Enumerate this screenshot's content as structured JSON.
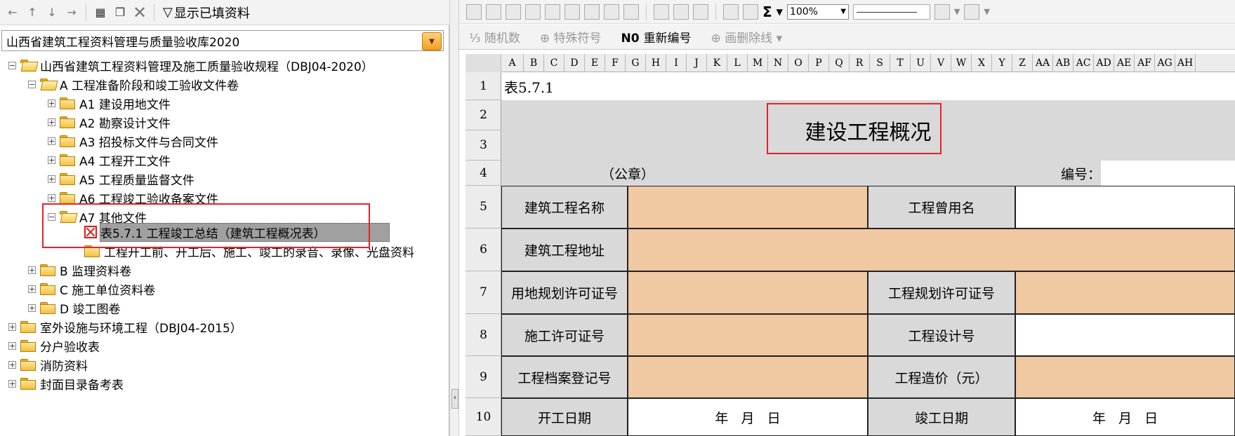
{
  "left_toolbar": {
    "show_filled_label": "显示已填资料"
  },
  "library_combo": {
    "value": "山西省建筑工程资料管理与质量验收库2020"
  },
  "tree": [
    {
      "label": "山西省建筑工程资料管理及施工质量验收规程（DBJ04-2020）"
    },
    {
      "label": "A 工程准备阶段和竣工验收文件卷"
    },
    {
      "label": "A1 建设用地文件"
    },
    {
      "label": "A2 勘察设计文件"
    },
    {
      "label": "A3 招投标文件与合同文件"
    },
    {
      "label": "A4 工程开工文件"
    },
    {
      "label": "A5 工程质量监督文件"
    },
    {
      "label": "A6 工程竣工验收备案文件"
    },
    {
      "label": "A7 其他文件"
    },
    {
      "label": "表5.7.1 工程竣工总结（建筑工程概况表）"
    },
    {
      "label": "工程开工前、开工后、施工、竣工的录音、录像、光盘资料"
    },
    {
      "label": "B 监理资料卷"
    },
    {
      "label": "C 施工单位资料卷"
    },
    {
      "label": "D 竣工图卷"
    },
    {
      "label": "室外设施与环境工程（DBJ04-2015）"
    },
    {
      "label": "分户验收表"
    },
    {
      "label": "消防资料"
    },
    {
      "label": "封面目录备考表"
    }
  ],
  "right_toolbar": {
    "zoom": "100%",
    "random_number": "随机数",
    "special_symbol": "特殊符号",
    "renumber": "重新编号",
    "strikethrough": "画删除线",
    "sum_symbol": "Σ"
  },
  "columns": [
    "A",
    "B",
    "C",
    "D",
    "E",
    "F",
    "G",
    "H",
    "I",
    "J",
    "K",
    "L",
    "M",
    "N",
    "O",
    "P",
    "Q",
    "R",
    "S",
    "T",
    "U",
    "V",
    "W",
    "X",
    "Y",
    "Z",
    "AA",
    "AB",
    "AC",
    "AD",
    "AE",
    "AF",
    "AG",
    "AH"
  ],
  "rows": [
    "1",
    "2",
    "3",
    "4",
    "5",
    "6",
    "7",
    "8",
    "9",
    "10"
  ],
  "sheet": {
    "table_no": "表5.7.1",
    "title": "建设工程概况",
    "seal": "（公章）",
    "number_label": "编号：",
    "name_label": "建筑工程名称",
    "used_name_label": "工程曾用名",
    "address_label": "建筑工程地址",
    "land_permit_label": "用地规划许可证号",
    "planning_permit_label": "工程规划许可证号",
    "construction_permit_label": "施工许可证号",
    "design_no_label": "工程设计号",
    "archive_no_label": "工程档案登记号",
    "cost_label": "工程造价（元）",
    "start_date_label": "开工日期",
    "date_placeholder": "年   月   日",
    "completion_date_label": "竣工日期",
    "date_placeholder2": "年   月   日"
  },
  "colors": {
    "peach": "#f0c8a2",
    "gray": "#d9d9d9",
    "highlight_red": "#e8202a",
    "selection": "#a0a0a0"
  }
}
